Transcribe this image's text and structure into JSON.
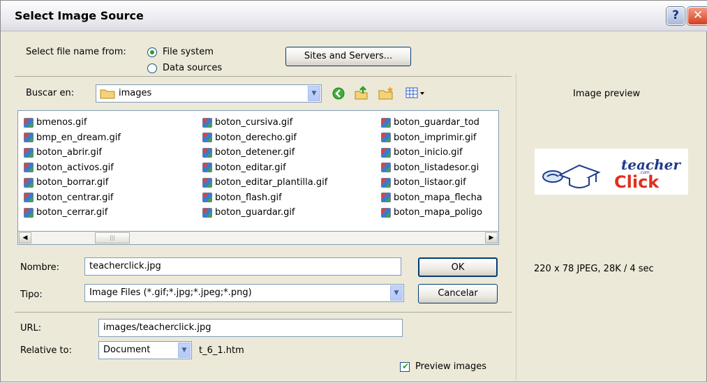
{
  "window": {
    "title": "Select Image Source",
    "help_glyph": "?",
    "close_glyph": "✕"
  },
  "source": {
    "label": "Select file name from:",
    "options": [
      "File system",
      "Data sources"
    ],
    "selected": "File system",
    "sites_button": "Sites and Servers..."
  },
  "browse": {
    "label": "Buscar en:",
    "folder": "images"
  },
  "files": {
    "columns": [
      [
        "bmenos.gif",
        "bmp_en_dream.gif",
        "boton_abrir.gif",
        "boton_activos.gif",
        "boton_borrar.gif",
        "boton_centrar.gif",
        "boton_cerrar.gif"
      ],
      [
        "boton_cursiva.gif",
        "boton_derecho.gif",
        "boton_detener.gif",
        "boton_editar.gif",
        "boton_editar_plantilla.gif",
        "boton_flash.gif",
        "boton_guardar.gif"
      ],
      [
        "boton_guardar_tod",
        "boton_imprimir.gif",
        "boton_inicio.gif",
        "boton_listadesor.gi",
        "boton_listaor.gif",
        "boton_mapa_flecha",
        "boton_mapa_poligo"
      ]
    ]
  },
  "form": {
    "name_label": "Nombre:",
    "name_value": "teacherclick.jpg",
    "type_label": "Tipo:",
    "type_value": "Image Files (*.gif;*.jpg;*.jpeg;*.png)",
    "ok_button": "OK",
    "cancel_button": "Cancelar",
    "url_label": "URL:",
    "url_value": "images/teacherclick.jpg",
    "relative_label": "Relative to:",
    "relative_value": "Document",
    "relative_file": "t_6_1.htm",
    "preview_checkbox": "Preview images",
    "preview_checked": true
  },
  "preview": {
    "heading": "Image preview",
    "logo_text_top": "teacher",
    "logo_text_bottom": "Click",
    "logo_small": ".com",
    "info": "220 x 78 JPEG, 28K / 4 sec"
  },
  "colors": {
    "logo_red": "#e0301e",
    "logo_blue": "#1f3b8a"
  }
}
